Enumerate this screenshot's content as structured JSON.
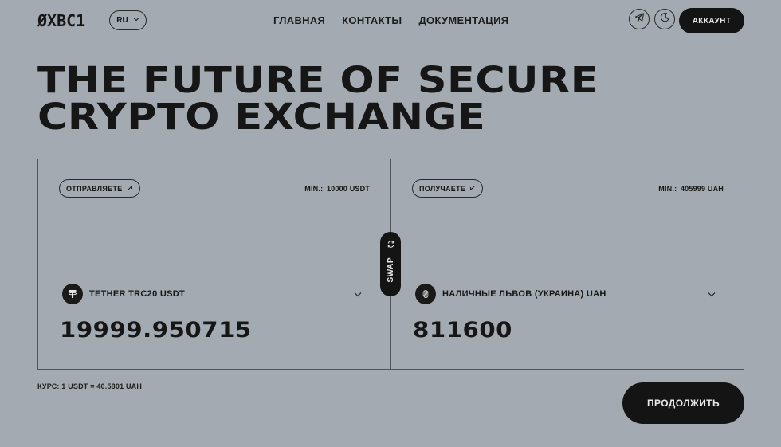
{
  "header": {
    "logo": "ØXBC1",
    "language": "RU",
    "nav": [
      "ГЛАВНАЯ",
      "КОНТАКТЫ",
      "ДОКУМЕНТАЦИЯ"
    ],
    "icons": [
      "telegram-icon",
      "moon-icon"
    ],
    "account_label": "АККАУНТ"
  },
  "hero": {
    "line1": "THE FUTURE OF SECURE",
    "line2": "CRYPTO EXCHANGE"
  },
  "exchange": {
    "send": {
      "pill_label": "ОТПРАВЛЯЕТЕ",
      "pill_icon": "arrow-up-right-icon",
      "min_label": "MIN.:",
      "min_value": "10000 USDT",
      "currency": "TETHER TRC20 USDT",
      "currency_icon": "tether-icon",
      "amount": "19999.950715"
    },
    "receive": {
      "pill_label": "ПОЛУЧАЕТЕ",
      "pill_icon": "arrow-down-left-icon",
      "min_label": "MIN.:",
      "min_value": "405999 UAH",
      "currency": "НАЛИЧНЫЕ ЛЬВОВ (УКРАИНА) UAH",
      "currency_icon": "hryvnia-icon",
      "amount": "811600"
    },
    "swap_label": "SWAP",
    "rate": "КУРС: 1 USDT = 40.5801 UAH",
    "continue_label": "ПРОДОЛЖИТЬ"
  },
  "colors": {
    "background": "#a4aab1",
    "dark": "#141414",
    "text": "#161616"
  }
}
